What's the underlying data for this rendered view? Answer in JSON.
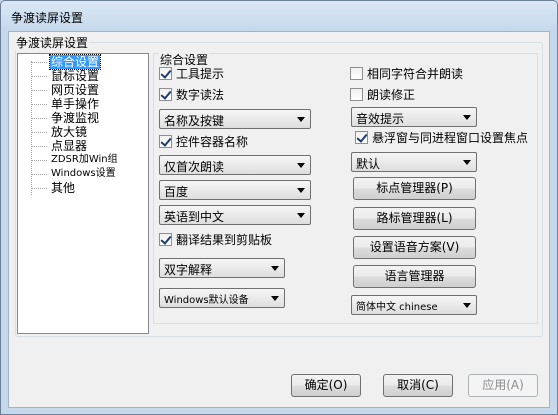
{
  "window": {
    "title": "争渡读屏设置"
  },
  "group": {
    "title": "争渡读屏设置"
  },
  "tree": {
    "items": [
      "综合设置",
      "鼠标设置",
      "网页设置",
      "单手操作",
      "争渡监视",
      "放大镜",
      "点显器",
      "ZDSR加Win组",
      "Windows设置",
      "其他"
    ],
    "selected_index": 0
  },
  "panel": {
    "title": "综合设置",
    "tooltip_check": {
      "label": "工具提示",
      "checked": true
    },
    "digit_check": {
      "label": "数字读法",
      "checked": true
    },
    "same_char_check": {
      "label": "相同字符合并朗读",
      "checked": false
    },
    "read_fix_check": {
      "label": "朗读修正",
      "checked": false
    },
    "name_hotkey_combo": {
      "value": "名称及按键"
    },
    "sound_hint_combo": {
      "value": "音效提示"
    },
    "control_container_check": {
      "label": "控件容器名称",
      "checked": true
    },
    "float_focus_check": {
      "label": "悬浮窗与同进程窗口设置焦点",
      "checked": true
    },
    "first_read_combo": {
      "value": "仅首次朗读"
    },
    "default_combo": {
      "value": "默认"
    },
    "baidu_combo": {
      "value": "百度"
    },
    "translate_combo": {
      "value": "英语到中文"
    },
    "copy_check": {
      "label": "翻译结果到剪贴板",
      "checked": true
    },
    "double_char_combo": {
      "value": "双字解释"
    },
    "audio_device_combo": {
      "value": "Windows默认设备"
    },
    "language_combo": {
      "value": "简体中文 chinese"
    },
    "bookmark_button": "标点管理器(P)",
    "route_button": "路标管理器(L)",
    "voice_scheme_button": "设置语音方案(V)",
    "language_manager_button": "语言管理器"
  },
  "footer": {
    "ok": "确定(O)",
    "cancel": "取消(C)",
    "apply": "应用(A)"
  }
}
